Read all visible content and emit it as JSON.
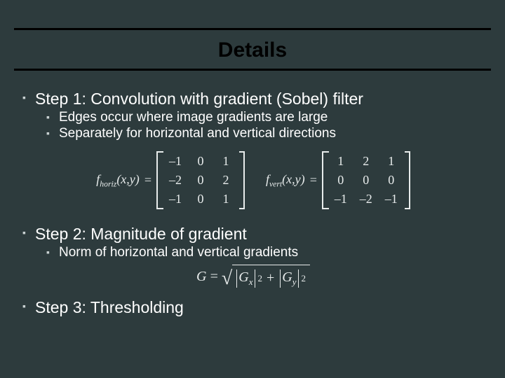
{
  "title": "Details",
  "steps": [
    {
      "label": "Step 1: Convolution with gradient (Sobel) filter",
      "subs": [
        "Edges occur where image gradients are large",
        "Separately for horizontal and vertical directions"
      ]
    },
    {
      "label": "Step 2: Magnitude of gradient",
      "subs": [
        "Norm of horizontal and vertical gradients"
      ]
    },
    {
      "label": "Step 3: Thresholding",
      "subs": []
    }
  ],
  "filters": {
    "horiz": {
      "fn_prefix": "f",
      "fn_sub": "horiz",
      "args": "(x,y)",
      "eq": "=",
      "m": [
        [
          "–1",
          "0",
          "1"
        ],
        [
          "–2",
          "0",
          "2"
        ],
        [
          "–1",
          "0",
          "1"
        ]
      ]
    },
    "vert": {
      "fn_prefix": "f",
      "fn_sub": "vert",
      "args": "(x,y)",
      "eq": "=",
      "m": [
        [
          "1",
          "2",
          "1"
        ],
        [
          "0",
          "0",
          "0"
        ],
        [
          "–1",
          "–2",
          "–1"
        ]
      ]
    }
  },
  "magnitude": {
    "G": "G",
    "eq": "=",
    "Gx": "G",
    "x": "x",
    "Gy": "G",
    "y": "y",
    "plus": "+",
    "sq": "2"
  }
}
